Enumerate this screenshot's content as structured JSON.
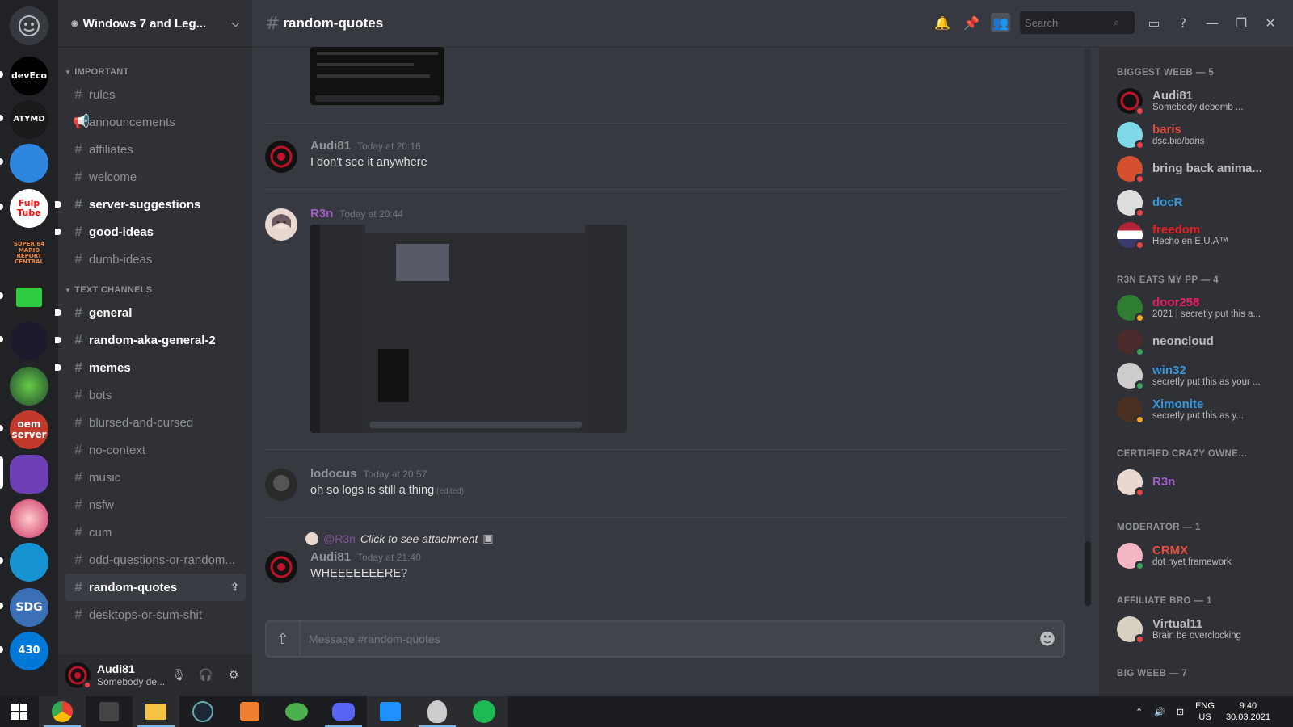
{
  "server": {
    "name": "Windows 7 and Leg..."
  },
  "categories": {
    "important": "IMPORTANT",
    "text_channels": "TEXT CHANNELS"
  },
  "channels_important": [
    {
      "name": "rules",
      "state": "muted"
    },
    {
      "name": "announcements",
      "state": "muted",
      "icon": "megaphone-icon"
    },
    {
      "name": "affiliates",
      "state": "muted"
    },
    {
      "name": "welcome",
      "state": "muted"
    },
    {
      "name": "server-suggestions",
      "state": "unread"
    },
    {
      "name": "good-ideas",
      "state": "unread"
    },
    {
      "name": "dumb-ideas",
      "state": "muted"
    }
  ],
  "channels_text": [
    {
      "name": "general",
      "state": "unread"
    },
    {
      "name": "random-aka-general-2",
      "state": "unread"
    },
    {
      "name": "memes",
      "state": "unread"
    },
    {
      "name": "bots",
      "state": "muted"
    },
    {
      "name": "blursed-and-cursed",
      "state": "muted"
    },
    {
      "name": "no-context",
      "state": "muted"
    },
    {
      "name": "music",
      "state": "muted"
    },
    {
      "name": "nsfw",
      "state": "muted"
    },
    {
      "name": "cum",
      "state": "muted"
    },
    {
      "name": "odd-questions-or-random...",
      "state": "muted"
    },
    {
      "name": "random-quotes",
      "state": "active"
    },
    {
      "name": "desktops-or-sum-shit",
      "state": "muted"
    }
  ],
  "user_panel": {
    "name": "Audi81",
    "status": "Somebody de..."
  },
  "chat": {
    "channel": "random-quotes",
    "composer_placeholder": "Message #random-quotes",
    "search_placeholder": "Search"
  },
  "messages": [
    {
      "author": "Audi81",
      "color": "#8e9297",
      "time": "Today at 20:16",
      "text": "I don't see it anywhere"
    },
    {
      "author": "R3n",
      "color": "#a15dc6",
      "time": "Today at 20:44",
      "text": ""
    },
    {
      "author": "lodocus",
      "color": "#8e9297",
      "time": "Today at 20:57",
      "text": "oh so logs is still a thing",
      "edited": "(edited)"
    },
    {
      "author": "Audi81",
      "color": "#8e9297",
      "time": "Today at 21:40",
      "text": "WHEEEEEEERE?",
      "reply_to": "@R3n",
      "reply_text": "Click to see attachment"
    }
  ],
  "member_groups": [
    {
      "title": "BIGGEST WEEB — 5"
    },
    {
      "title": "R3N EATS MY PP — 4"
    },
    {
      "title": "CERTIFIED CRAZY OWNE..."
    },
    {
      "title": "MODERATOR — 1"
    },
    {
      "title": "AFFILIATE BRO — 1"
    },
    {
      "title": "BIG WEEB — 7"
    }
  ],
  "members": [
    {
      "name": "Audi81",
      "status": "Somebody debomb ...",
      "color": "#b9bbbe",
      "presence": "dnd"
    },
    {
      "name": "baris",
      "status": "dsc.bio/baris",
      "color": "#e74c3c",
      "presence": "dnd"
    },
    {
      "name": "bring back anima...",
      "status": "",
      "color": "#b9bbbe",
      "presence": "dnd"
    },
    {
      "name": "docR",
      "status": "",
      "color": "#3498db",
      "presence": "dnd"
    },
    {
      "name": "freedom",
      "status": "Hecho en E.U.A™",
      "color": "#e91e1e",
      "presence": "dnd"
    },
    {
      "name": "door258",
      "status": "2021 | secretly put this a...",
      "color": "#e91e63",
      "presence": "idle"
    },
    {
      "name": "neoncloud",
      "status": "",
      "color": "#b9bbbe",
      "presence": "online"
    },
    {
      "name": "win32",
      "status": "secretly put this as your ...",
      "color": "#3498db",
      "presence": "online"
    },
    {
      "name": "Ximonite",
      "status": "secretly put this as y...",
      "color": "#3498db",
      "presence": "idle"
    },
    {
      "name": "R3n",
      "status": "",
      "color": "#a15dc6",
      "presence": "dnd"
    },
    {
      "name": "CRMX",
      "status": "dot nyet framework",
      "color": "#e74c3c",
      "presence": "online"
    },
    {
      "name": "Virtual11",
      "status": "Brain be overclocking",
      "color": "#b9bbbe",
      "presence": "dnd"
    }
  ],
  "guilds": [
    {
      "label": "devEco"
    },
    {
      "label": "ATYMD"
    },
    {
      "label": ""
    },
    {
      "label": "Fulp Tube"
    },
    {
      "label": "SUPER 64 MARIO REPORT CENTRAL"
    },
    {
      "label": ""
    },
    {
      "label": ""
    },
    {
      "label": ""
    },
    {
      "label": "oem server"
    },
    {
      "label": ""
    },
    {
      "label": ""
    },
    {
      "label": ""
    },
    {
      "label": "SDG"
    },
    {
      "label": "430"
    }
  ],
  "taskbar": {
    "lang_top": "ENG",
    "lang_bottom": "US",
    "time": "9:40",
    "date": "30.03.2021"
  }
}
